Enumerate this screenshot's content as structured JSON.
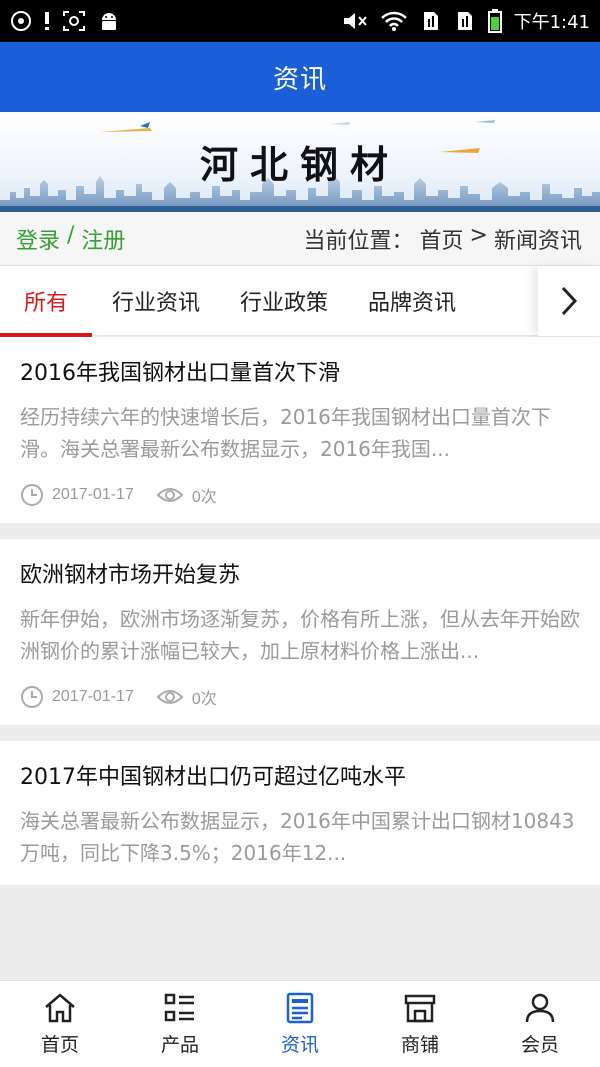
{
  "statusbar": {
    "time": "下午1:41"
  },
  "header": {
    "title": "资讯"
  },
  "banner": {
    "title": "河北钢材"
  },
  "crumbbar": {
    "login": "登录",
    "separator": " / ",
    "register": "注册",
    "location_prefix": "当前位置：",
    "home": "首页",
    "arrow": ">",
    "current": "新闻资讯"
  },
  "tabs": [
    {
      "label": "所有"
    },
    {
      "label": "行业资讯"
    },
    {
      "label": "行业政策"
    },
    {
      "label": "品牌资讯"
    }
  ],
  "news": [
    {
      "title": "2016年我国钢材出口量首次下滑",
      "desc": "经历持续六年的快速增长后，2016年我国钢材出口量首次下滑。海关总署最新公布数据显示，2016年我国...",
      "date": "2017-01-17",
      "views": "0次"
    },
    {
      "title": "欧洲钢材市场开始复苏",
      "desc": "新年伊始，欧洲市场逐渐复苏，价格有所上涨，但从去年开始欧洲钢价的累计涨幅已较大，加上原材料价格上涨出...",
      "date": "2017-01-17",
      "views": "0次"
    },
    {
      "title": "2017年中国钢材出口仍可超过亿吨水平",
      "desc": "海关总署最新公布数据显示，2016年中国累计出口钢材10843万吨，同比下降3.5%；2016年12...",
      "date": "",
      "views": ""
    }
  ],
  "bottomnav": {
    "items": [
      {
        "label": "首页",
        "icon": "home-icon"
      },
      {
        "label": "产品",
        "icon": "list-icon"
      },
      {
        "label": "资讯",
        "icon": "document-icon"
      },
      {
        "label": "商铺",
        "icon": "store-icon"
      },
      {
        "label": "会员",
        "icon": "user-icon"
      }
    ]
  },
  "colors": {
    "header_bg": "#1b5fd6",
    "active_tab": "#d7191a",
    "login_green": "#33a133",
    "nav_active": "#1b5fd6"
  }
}
